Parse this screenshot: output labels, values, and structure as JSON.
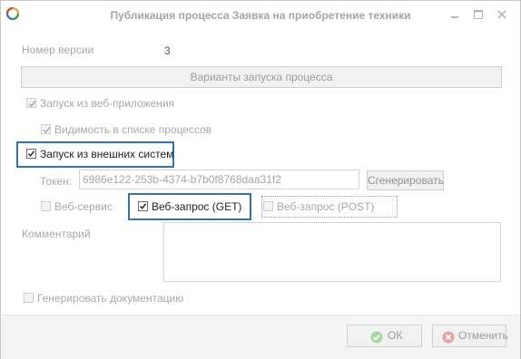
{
  "window": {
    "title": "Публикация процесса Заявка на приобретение техники"
  },
  "version": {
    "label": "Номер версии",
    "value": "3"
  },
  "section_header": "Варианты запуска процесса",
  "options": {
    "web_app": {
      "label": "Запуск из веб-приложения",
      "checked": true,
      "enabled": false
    },
    "process_list": {
      "label": "Видимость в списке процессов",
      "checked": true,
      "enabled": false
    },
    "external": {
      "label": "Запуск из внешних систем",
      "checked": true,
      "enabled": true
    }
  },
  "token": {
    "label": "Токен:",
    "value": "6986e122-253b-4374-b7b0f8768daa31f2",
    "generate_label": "Сгенерировать"
  },
  "methods": {
    "web_service": {
      "label": "Веб-сервис",
      "checked": false
    },
    "get": {
      "label": "Веб-запрос (GET)",
      "checked": true
    },
    "post": {
      "label": "Веб-запрос (POST)",
      "checked": false
    }
  },
  "comment": {
    "label": "Комментарий",
    "value": ""
  },
  "docs": {
    "label": "Генерировать документацию",
    "checked": false
  },
  "footer": {
    "ok_label": "ОК",
    "cancel_label": "Отменить"
  },
  "colors": {
    "highlight": "#2e73b3",
    "ok_icon": "#a6d7a0",
    "cancel_icon": "#e7a2a2"
  },
  "icons": {
    "app": "app-logo-icon",
    "minimize": "minimize-icon",
    "maximize": "maximize-icon",
    "close": "close-icon"
  }
}
